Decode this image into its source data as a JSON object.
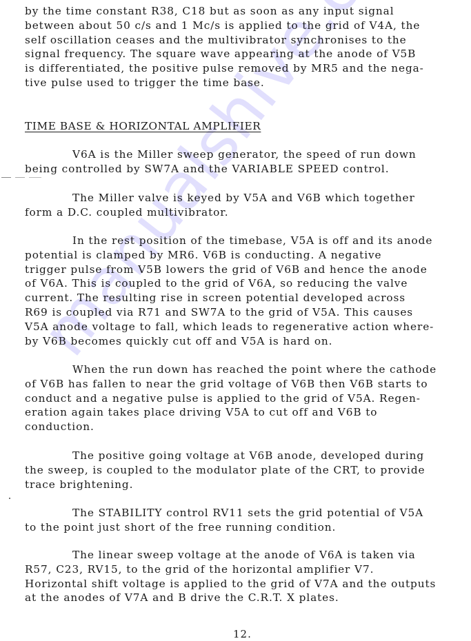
{
  "watermark": "manualshive.com",
  "intro_paragraph": [
    "by the time constant R38, C18 but as soon as any input signal",
    "between about 50 c/s and 1 Mc/s is applied to the grid of V4A, the",
    "self oscillation ceases and the multivibrator synchronises to the",
    "signal frequency.  The square wave appearing at the anode of V5B",
    "is differentiated, the positive pulse removed by MR5 and the nega-",
    "tive pulse used to trigger the time base."
  ],
  "section": {
    "heading": "TIME BASE & HORIZONTAL AMPLIFIER",
    "paragraphs": [
      [
        "V6A is the Miller sweep generator, the speed of run down",
        "being controlled by SW7A and the VARIABLE SPEED control."
      ],
      [
        "The Miller valve is keyed by V5A and V6B which together",
        "form a D.C. coupled multivibrator."
      ],
      [
        "In the rest position of the timebase, V5A is off and its anode",
        "potential is clamped by MR6.  V6B is conducting.  A negative",
        "trigger pulse from V5B lowers the grid of V6B and hence the anode",
        "of V6A.  This is coupled to the grid of V6A, so reducing the valve",
        "current.  The resulting rise in screen potential developed across",
        "R69 is coupled via R71 and SW7A to the grid of V5A.  This causes",
        "V5A anode voltage to fall, which leads to regenerative action where-",
        "by V6B becomes quickly cut off and V5A is hard on."
      ],
      [
        "When the run down has reached the point where the cathode",
        "of V6B has fallen to near the grid voltage of V6B then V6B starts to",
        "conduct and a negative pulse is applied to the grid of V5A.   Regen-",
        "eration again takes place driving V5A to cut off and V6B to",
        "conduction."
      ],
      [
        "The positive going voltage at V6B anode, developed during",
        "the sweep, is coupled to the modulator plate of the CRT, to provide",
        "trace brightening."
      ],
      [
        "The STABILITY control RV11 sets the grid potential of V5A",
        "to the point just short of the free running condition."
      ],
      [
        "The linear sweep voltage at the anode of V6A is taken via",
        "R57, C23, RV15, to the grid of the horizontal amplifier V7.",
        "Horizontal shift voltage is applied to the grid of V7A and the outputs",
        "at the anodes of V7A and B drive the C.R.T. X plates."
      ]
    ]
  },
  "page_number": "12."
}
